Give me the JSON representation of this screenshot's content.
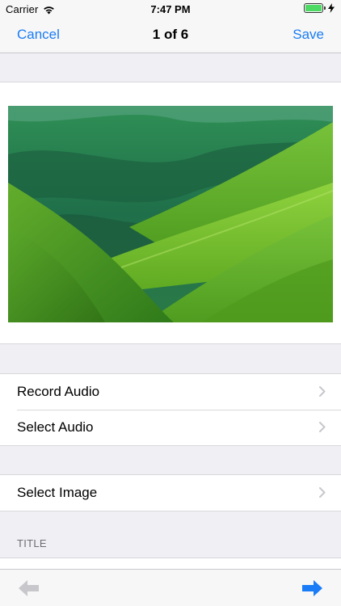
{
  "status_bar": {
    "carrier": "Carrier",
    "time": "7:47 PM",
    "wifi_icon": "wifi-icon",
    "battery_icon": "battery-icon",
    "battery_level": 1.0,
    "charging_icon": "charging-bolt-icon"
  },
  "nav": {
    "cancel_label": "Cancel",
    "title": "1 of 6",
    "save_label": "Save"
  },
  "media": {
    "image_description_icon": "landscape-photo"
  },
  "audio_rows": [
    {
      "label": "Record Audio",
      "icon": "chevron-right-icon"
    },
    {
      "label": "Select Audio",
      "icon": "chevron-right-icon"
    }
  ],
  "image_rows": [
    {
      "label": "Select Image",
      "icon": "chevron-right-icon"
    }
  ],
  "title_section": {
    "header": "TITLE"
  },
  "toolbar": {
    "prev_icon": "arrow-left-icon",
    "next_icon": "arrow-right-icon"
  },
  "colors": {
    "accent": "#1a7cf6",
    "background": "#efeff4",
    "separator": "#d8d8dc",
    "disabled": "#c7c7cc"
  }
}
